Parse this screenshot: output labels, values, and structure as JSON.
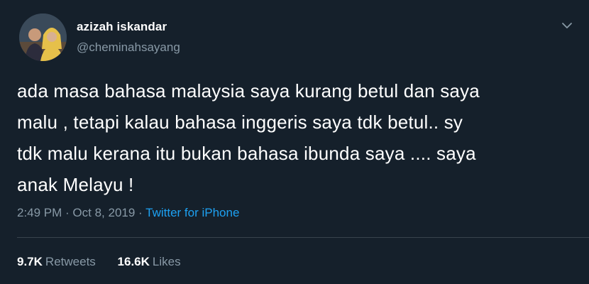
{
  "author": {
    "display_name": "azizah iskandar",
    "handle": "@cheminahsayang"
  },
  "tweet": {
    "lines": [
      "ada masa bahasa malaysia saya kurang betul dan saya",
      "malu , tetapi kalau bahasa inggeris saya tdk betul.. sy",
      "tdk malu kerana itu bukan bahasa ibunda saya .... saya",
      "anak Melayu !"
    ],
    "time": "2:49 PM",
    "date": "Oct 8, 2019",
    "separator1": " · ",
    "separator2": " · ",
    "source": "Twitter for iPhone"
  },
  "stats": {
    "retweets_count": "9.7K",
    "retweets_label": "Retweets",
    "likes_count": "16.6K",
    "likes_label": "Likes"
  },
  "icons": {
    "menu": "chevron-down-icon"
  },
  "colors": {
    "background": "#15202b",
    "text": "#ffffff",
    "muted": "#8899a6",
    "link": "#1da1f2",
    "divider": "#38444d"
  }
}
